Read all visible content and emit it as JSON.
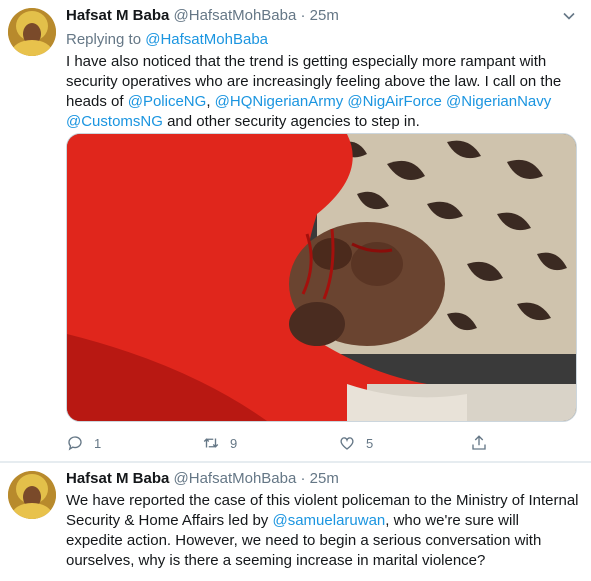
{
  "tweets": [
    {
      "author_name": "Hafsat M Baba",
      "handle": "@HafsatMohBaba",
      "separator": "·",
      "time": "25m",
      "replying_to_label": "Replying to",
      "replying_to_handle": "@HafsatMohBaba",
      "text_part1": "I have also noticed that the trend is getting especially more rampant with security operatives who are increasingly feeling above the law. I call on the heads of ",
      "mention1": "@PoliceNG",
      "sep1": ", ",
      "mention2": "@HQNigerianArmy",
      "sep2": " ",
      "mention3": "@NigAirForce",
      "sep3": " ",
      "mention4": "@NigerianNavy",
      "sep4": " ",
      "mention5": "@CustomsNG",
      "text_part2": " and other security agencies to step in.",
      "reply_count": "1",
      "retweet_count": "9",
      "like_count": "5",
      "icons": [
        "comment-icon",
        "retweet-icon",
        "like-icon",
        "share-icon",
        "caret-down-icon"
      ]
    },
    {
      "author_name": "Hafsat M Baba",
      "handle": "@HafsatMohBaba",
      "separator": "·",
      "time": "25m",
      "text_part1": "We have reported the case of this violent policeman to the Ministry of Internal Security & Home Affairs led by ",
      "mention1": "@samuelaruwan",
      "text_part2": ", who we're sure will expedite action. However, we need to begin a serious conversation with ourselves, why is there a seeming increase in marital violence?"
    }
  ],
  "colors": {
    "link": "#1b95e0",
    "secondary_text": "#657786",
    "border": "#e6ecf0"
  }
}
